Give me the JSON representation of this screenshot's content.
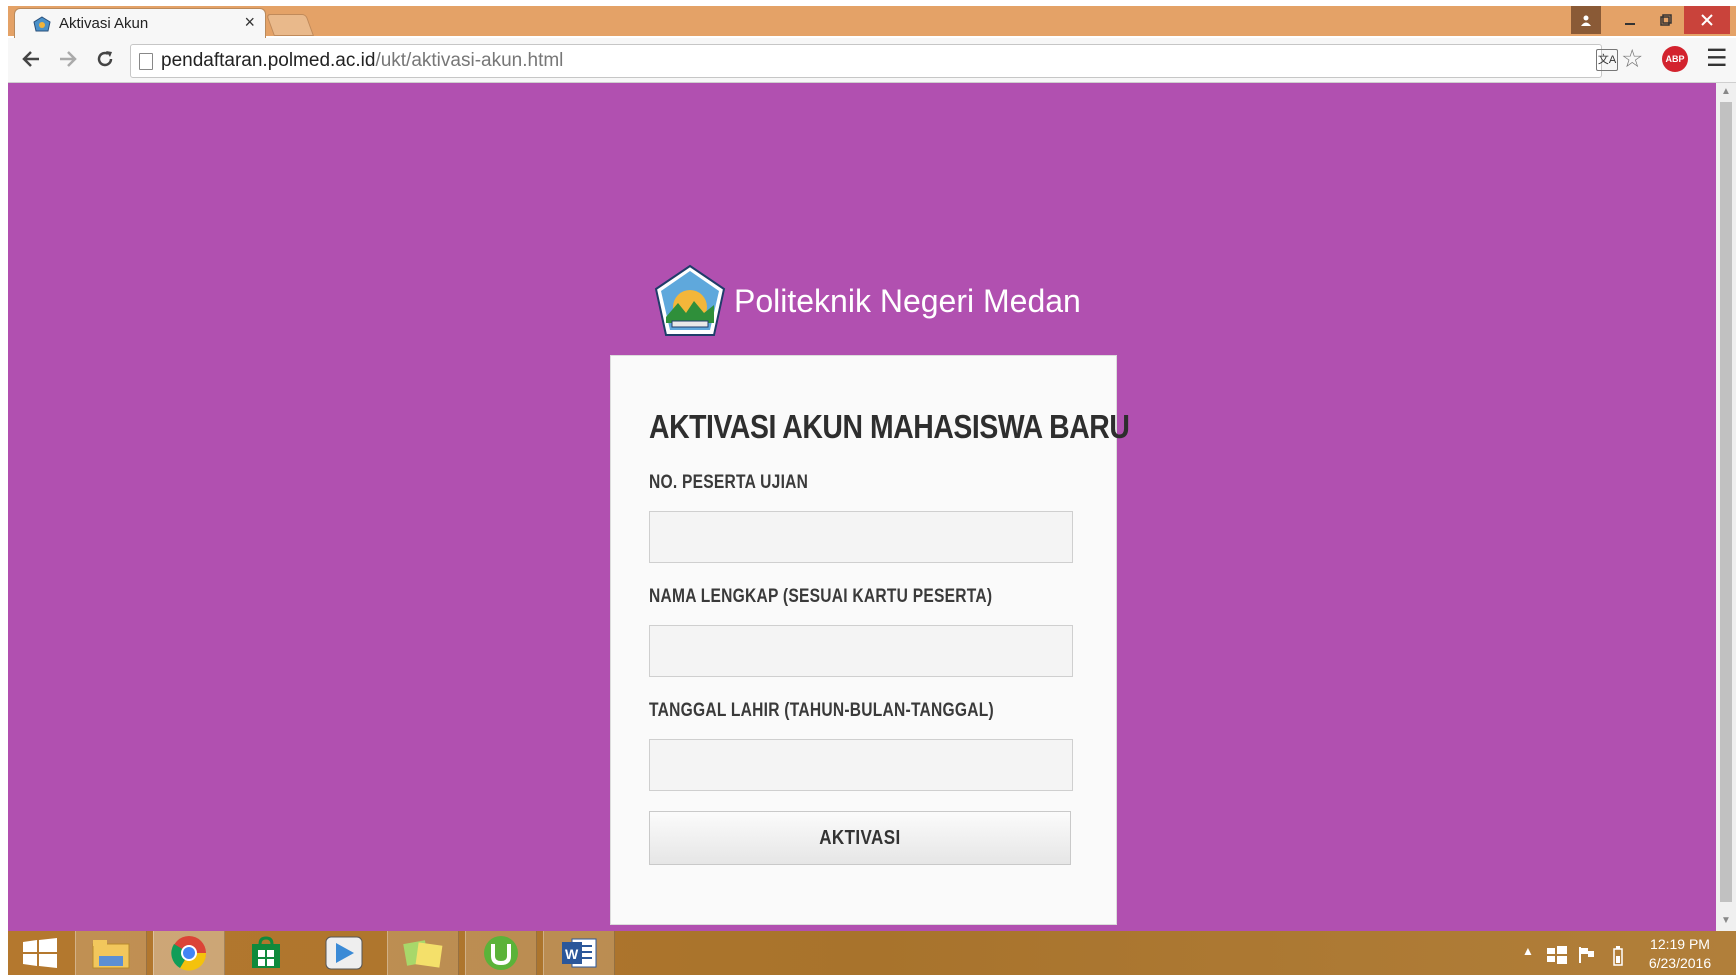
{
  "browser": {
    "tab_title": "Aktivasi Akun",
    "tab_close": "×",
    "url_host": "pendaftaran.polmed.ac.id",
    "url_path": "/ukt/aktivasi-akun.html",
    "adblock_label": "ABP",
    "translate_label": "文A"
  },
  "page": {
    "background_color": "#b150b0",
    "brand_name": "Politeknik Negeri Medan",
    "form": {
      "title": "AKTIVASI AKUN MAHASISWA BARU",
      "fields": [
        {
          "label": "NO. PESERTA UJIAN",
          "value": ""
        },
        {
          "label": "NAMA LENGKAP (SESUAI KARTU PESERTA)",
          "value": ""
        },
        {
          "label": "TANGGAL LAHIR (TAHUN-BULAN-TANGGAL)",
          "value": ""
        }
      ],
      "submit_label": "AKTIVASI"
    }
  },
  "taskbar": {
    "apps": [
      "windows-start-icon",
      "file-explorer-icon",
      "chrome-icon",
      "store-icon",
      "media-player-icon",
      "sticky-notes-icon",
      "utorrent-icon",
      "word-icon"
    ],
    "time": "12:19 PM",
    "date": "6/23/2016"
  }
}
